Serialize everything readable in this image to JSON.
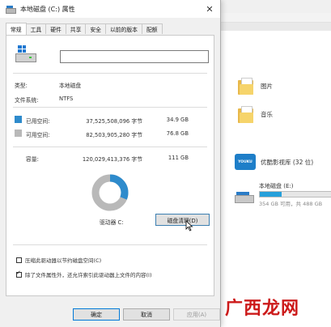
{
  "window": {
    "title": "本地磁盘 (C:) 属性",
    "close_glyph": "✕"
  },
  "tabs": [
    {
      "label": "常规",
      "active": true
    },
    {
      "label": "工具"
    },
    {
      "label": "硬件"
    },
    {
      "label": "共享"
    },
    {
      "label": "安全"
    },
    {
      "label": "以前的版本"
    },
    {
      "label": "配额"
    }
  ],
  "general": {
    "name_value": "",
    "type_label": "类型:",
    "type_value": "本地磁盘",
    "fs_label": "文件系统:",
    "fs_value": "NTFS",
    "used": {
      "label": "已用空间:",
      "bytes": "37,525,508,096 字节",
      "size": "34.9 GB",
      "color": "#2e8bcc"
    },
    "free": {
      "label": "可用空间:",
      "bytes": "82,503,905,280 字节",
      "size": "76.8 GB",
      "color": "#b9b9b9"
    },
    "capacity": {
      "label": "容量:",
      "bytes": "120,029,413,376 字节",
      "size": "111 GB"
    },
    "used_fraction": 0.3126,
    "drive_label": "驱动器 C:",
    "cleanup_button": "磁盘清理(D)",
    "compress_label": "压缩此驱动器以节约磁盘空间(C)",
    "compress_checked": false,
    "index_label": "除了文件属性外，还允许索引此驱动器上文件的内容(I)",
    "index_checked": true
  },
  "buttons": {
    "ok": "确定",
    "cancel": "取消",
    "apply": "应用(A)"
  },
  "explorer": {
    "pictures_label": "图片",
    "music_label": "音乐",
    "youku_label": "优酷影视库 (32 位)",
    "youku_icon_text": "YOUKU",
    "drive_name": "本地磁盘 (E:)",
    "drive_info": "354 GB 可用，共 488 GB",
    "drive_used_fraction": 0.27
  },
  "watermark": "广西龙网"
}
